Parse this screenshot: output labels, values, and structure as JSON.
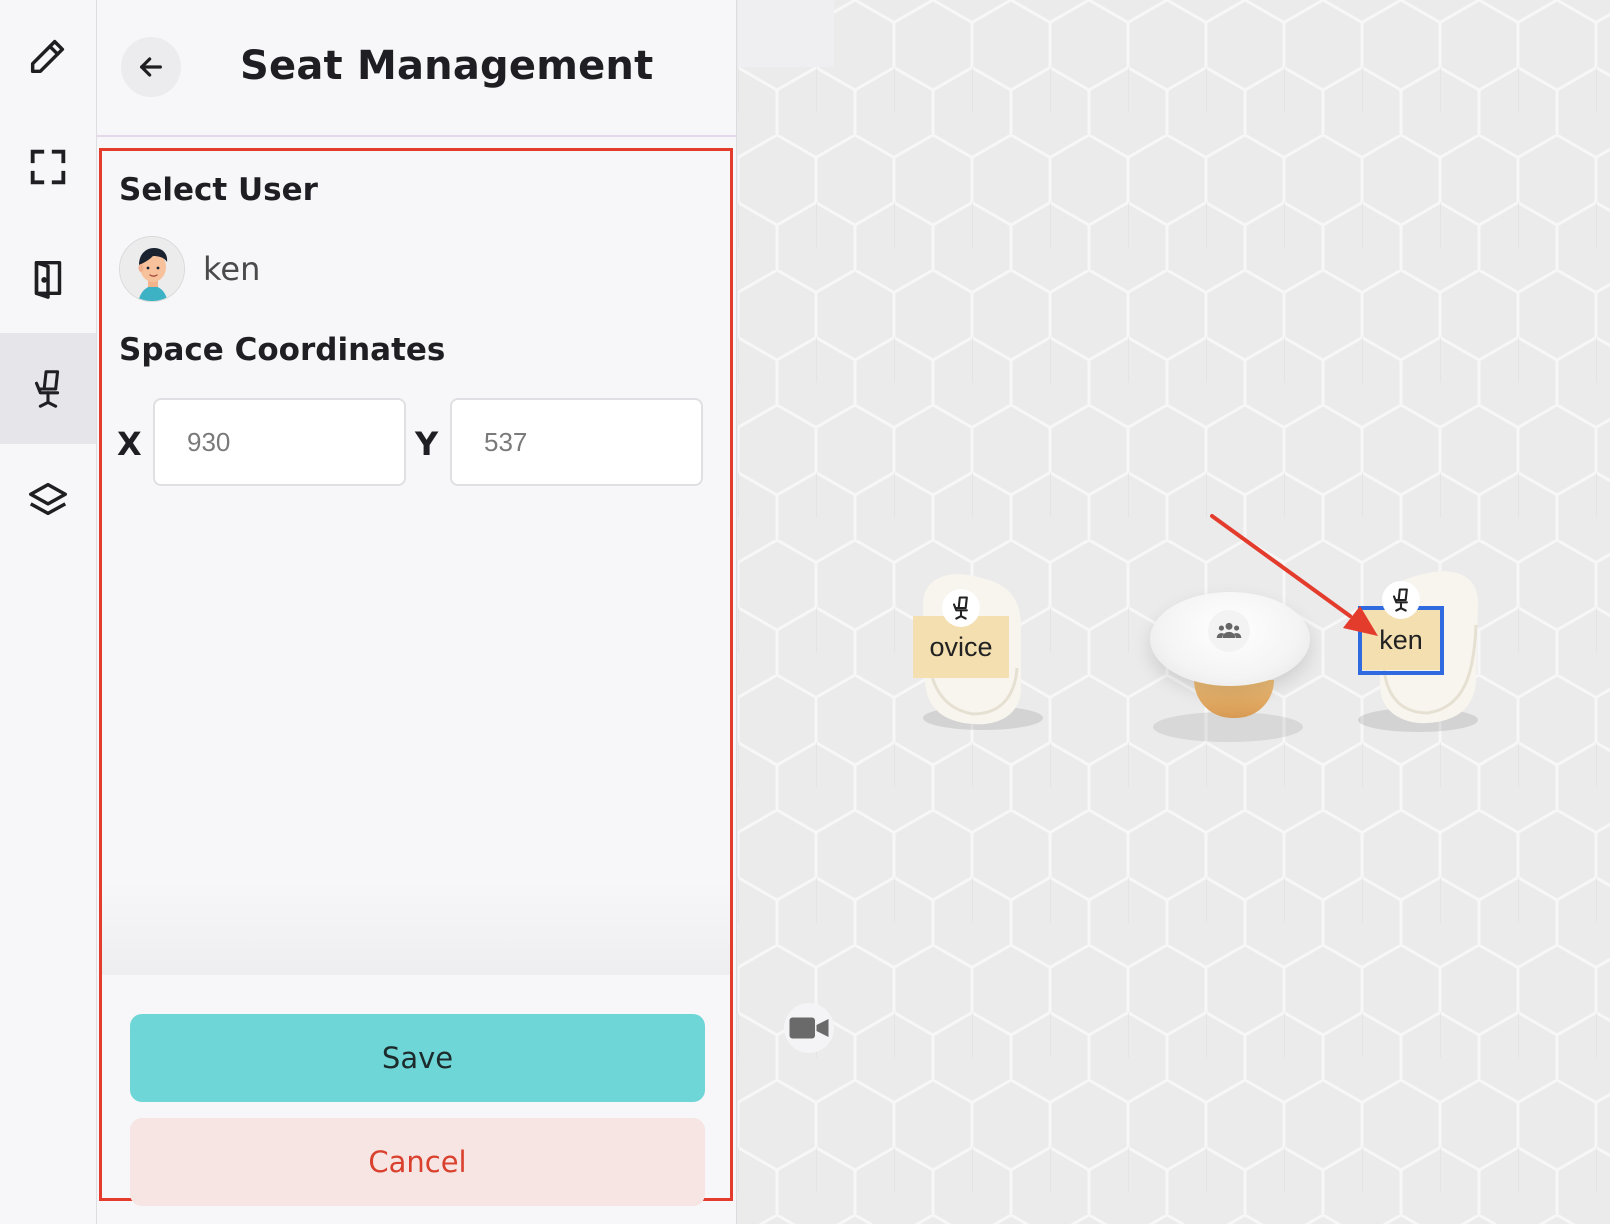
{
  "rail": {
    "items": [
      {
        "name": "edit",
        "icon": "pencil-icon",
        "active": false
      },
      {
        "name": "fullscreen",
        "icon": "expand-corners-icon",
        "active": false
      },
      {
        "name": "door",
        "icon": "door-icon",
        "active": false
      },
      {
        "name": "seats",
        "icon": "office-chair-icon",
        "active": true
      },
      {
        "name": "layers",
        "icon": "layers-icon",
        "active": false
      }
    ]
  },
  "panel": {
    "title": "Seat Management",
    "back_icon": "arrow-left-icon",
    "select_user_label": "Select User",
    "user": {
      "name": "ken",
      "avatar_icon": "user-avatar-icon"
    },
    "coordinates_label": "Space Coordinates",
    "x_label": "X",
    "x_value": "930",
    "y_label": "Y",
    "y_value": "537",
    "save_label": "Save",
    "cancel_label": "Cancel"
  },
  "canvas": {
    "seats": [
      {
        "label": "ovice",
        "icon": "office-chair-icon",
        "selected": false
      },
      {
        "label": "ken",
        "icon": "office-chair-icon",
        "selected": true
      }
    ],
    "group_table_icon": "group-users-icon",
    "video_icon": "video-camera-icon"
  },
  "colors": {
    "annotation": "#e33b2c",
    "selection": "#2f6ae0",
    "save_button": "#6ed6d7",
    "cancel_button_bg": "#f6e5e2",
    "cancel_text": "#d9402d",
    "seat_label_bg": "#f3dfb0"
  }
}
